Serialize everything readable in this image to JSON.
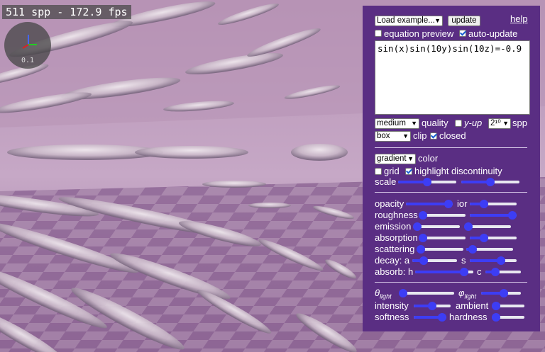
{
  "overlay": {
    "fps_text": "511 spp - 172.9 fps",
    "gizmo_scale": "0.1"
  },
  "toolbar": {
    "example_select": "Load example...",
    "update_label": "update",
    "help_label": "help"
  },
  "options": {
    "equation_preview_label": "equation preview",
    "equation_preview_checked": false,
    "auto_update_label": "auto-update",
    "auto_update_checked": true
  },
  "equation": {
    "value": "sin(x)sin(10y)sin(10z)=-0.9"
  },
  "render": {
    "quality_select": "medium",
    "quality_label": "quality",
    "y_up_label": "y-up",
    "y_up_checked": false,
    "spp_select": "2¹⁰",
    "spp_label": "spp",
    "clip_select": "box",
    "clip_label": "clip",
    "closed_label": "closed",
    "closed_checked": true
  },
  "color": {
    "color_select": "gradient",
    "color_label": "color",
    "grid_label": "grid",
    "grid_checked": false,
    "highlight_label": "highlight discontinuity",
    "highlight_checked": true,
    "scale_label": "scale",
    "scale_slider_1": 0.5,
    "scale_slider_2": 0.5
  },
  "material": {
    "opacity_label": "opacity",
    "opacity_value": 1.0,
    "ior_label": "ior",
    "ior_value": 0.25,
    "roughness_label": "roughness",
    "roughness_value": 0.0,
    "roughness_2_value": 1.0,
    "emission_label": "emission",
    "emission_value": 0.0,
    "emission_2_value": 0.0,
    "absorption_label": "absorption",
    "absorption_value": 0.0,
    "absorption_2_value": 0.25,
    "scattering_label": "scattering",
    "scattering_value": 0.0,
    "scattering_2_value": 0.05,
    "decay_a_label": "decay: a",
    "decay_a_value": 0.2,
    "decay_s_label": "s",
    "decay_s_value": 0.7,
    "absorb_h_label": "absorb: h",
    "absorb_h_value": 0.9,
    "absorb_c_label": "c",
    "absorb_c_value": 0.2
  },
  "lighting": {
    "theta_label": "θ",
    "theta_sub": "light",
    "theta_value": 0.0,
    "phi_label": "φ",
    "phi_sub": "light",
    "phi_value": 0.6,
    "intensity_label": "intensity",
    "intensity_value": 0.5,
    "ambient_label": "ambient",
    "ambient_value": 0.0,
    "softness_label": "softness",
    "softness_value": 1.0,
    "hardness_label": "hardness",
    "hardness_value": 0.0
  },
  "colors": {
    "panel_bg": "#5a2e83",
    "slider_accent": "#3d3df5"
  }
}
